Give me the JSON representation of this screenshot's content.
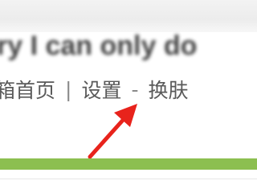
{
  "header": {
    "blurred_text": "ry I can only do"
  },
  "nav": {
    "home_label": "箱首页",
    "separator_1": "|",
    "settings_label": "设置",
    "separator_2": "-",
    "skin_label": "换肤"
  },
  "colors": {
    "accent_bar": "#8cbf50",
    "arrow": "#e8231c",
    "nav_text": "#5a5a5a"
  },
  "annotation": {
    "icon": "red-arrow-icon",
    "points_to": "设置"
  }
}
